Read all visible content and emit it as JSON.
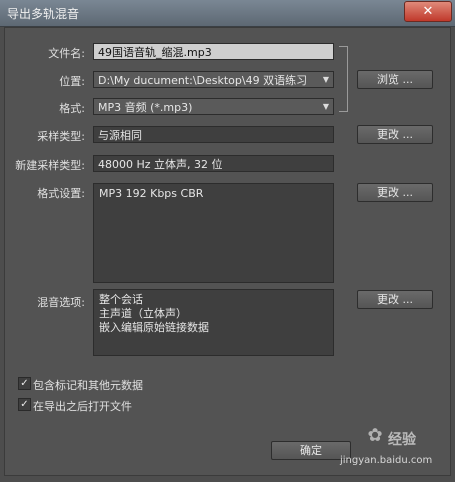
{
  "window": {
    "title": "导出多轨混音",
    "close_label": "✕"
  },
  "form": {
    "filename": {
      "label": "文件名:",
      "value": "49国语音轨_缩混.mp3"
    },
    "location": {
      "label": "位置:",
      "value": "D:\\My ducument:\\Desktop\\49 双语练习",
      "browse_label": "浏览 ..."
    },
    "format": {
      "label": "格式:",
      "value": "MP3 音频 (*.mp3)"
    },
    "sample_type": {
      "label": "采样类型:",
      "value": "与源相同",
      "change_label": "更改 ..."
    },
    "new_sample_type": {
      "label": "新建采样类型:",
      "value": "48000 Hz 立体声, 32 位"
    },
    "format_settings": {
      "label": "格式设置:",
      "value": "MP3 192 Kbps CBR",
      "change_label": "更改 ..."
    },
    "mix_options": {
      "label": "混音选项:",
      "lines": [
        "整个会话",
        "主声道（立体声）",
        "嵌入编辑原始链接数据"
      ],
      "change_label": "更改 ..."
    }
  },
  "checkboxes": [
    {
      "label": "包含标记和其他元数据",
      "checked": true
    },
    {
      "label": "在导出之后打开文件",
      "checked": true
    }
  ],
  "footer": {
    "ok_label": "确定"
  },
  "watermark": {
    "brand": "经验",
    "url": "jingyan.baidu.com"
  }
}
